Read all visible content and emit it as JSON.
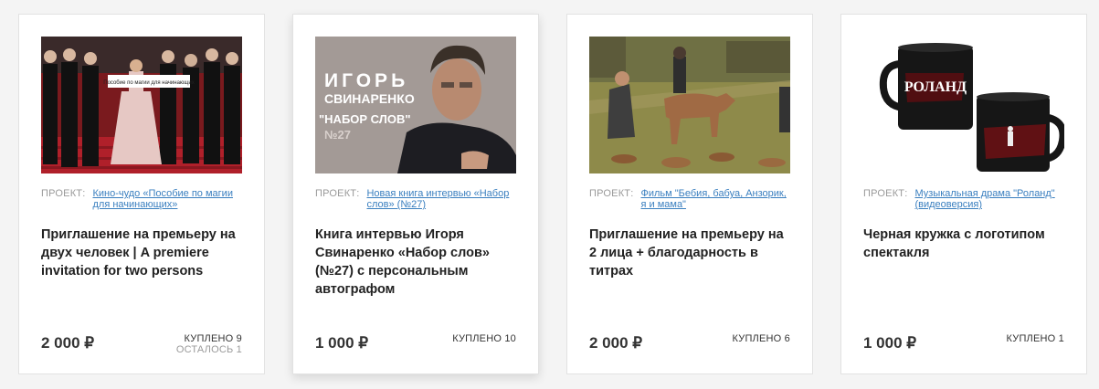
{
  "cards": [
    {
      "project_label": "ПРОЕКТ:",
      "project_link": "Кино-чудо «Пособие по магии для начинающих»",
      "title": "Приглашение на премьеру на двух человек | A premiere invitation for two persons",
      "price": "2 000 ₽",
      "bought": "КУПЛЕНО 9",
      "remaining": "ОСТАЛОСЬ 1",
      "image_text": "Пособие по магии для начинающих"
    },
    {
      "project_label": "ПРОЕКТ:",
      "project_link": "Новая книга интервью «Набор слов» (№27)",
      "title": "Книга интервью Игоря Свинаренко «Набор слов» (№27) с персональным автографом",
      "price": "1 000 ₽",
      "bought": "КУПЛЕНО 10",
      "image_text": {
        "line1": "ИГОРЬ",
        "line2": "СВИНАРЕНКО",
        "line3": "\"НАБОР СЛОВ\"",
        "line4": "№27"
      }
    },
    {
      "project_label": "ПРОЕКТ:",
      "project_link": "Фильм \"Бебия, бабуа, Анзорик, я и мама\"",
      "title": "Приглашение на премьеру на 2 лица + благодарность в титрах",
      "price": "2 000 ₽",
      "bought": "КУПЛЕНО 6"
    },
    {
      "project_label": "ПРОЕКТ:",
      "project_link": "Музыкальная драма \"Роланд\" (видеоверсия)",
      "title": "Черная кружка с логотипом спектакля",
      "price": "1 000 ₽",
      "bought": "КУПЛЕНО 1",
      "image_text": "РОЛАНД"
    }
  ],
  "colors": {
    "link": "#3a7fbf",
    "label": "#9a9a9a",
    "text": "#222222",
    "background": "#f4f4f4"
  }
}
